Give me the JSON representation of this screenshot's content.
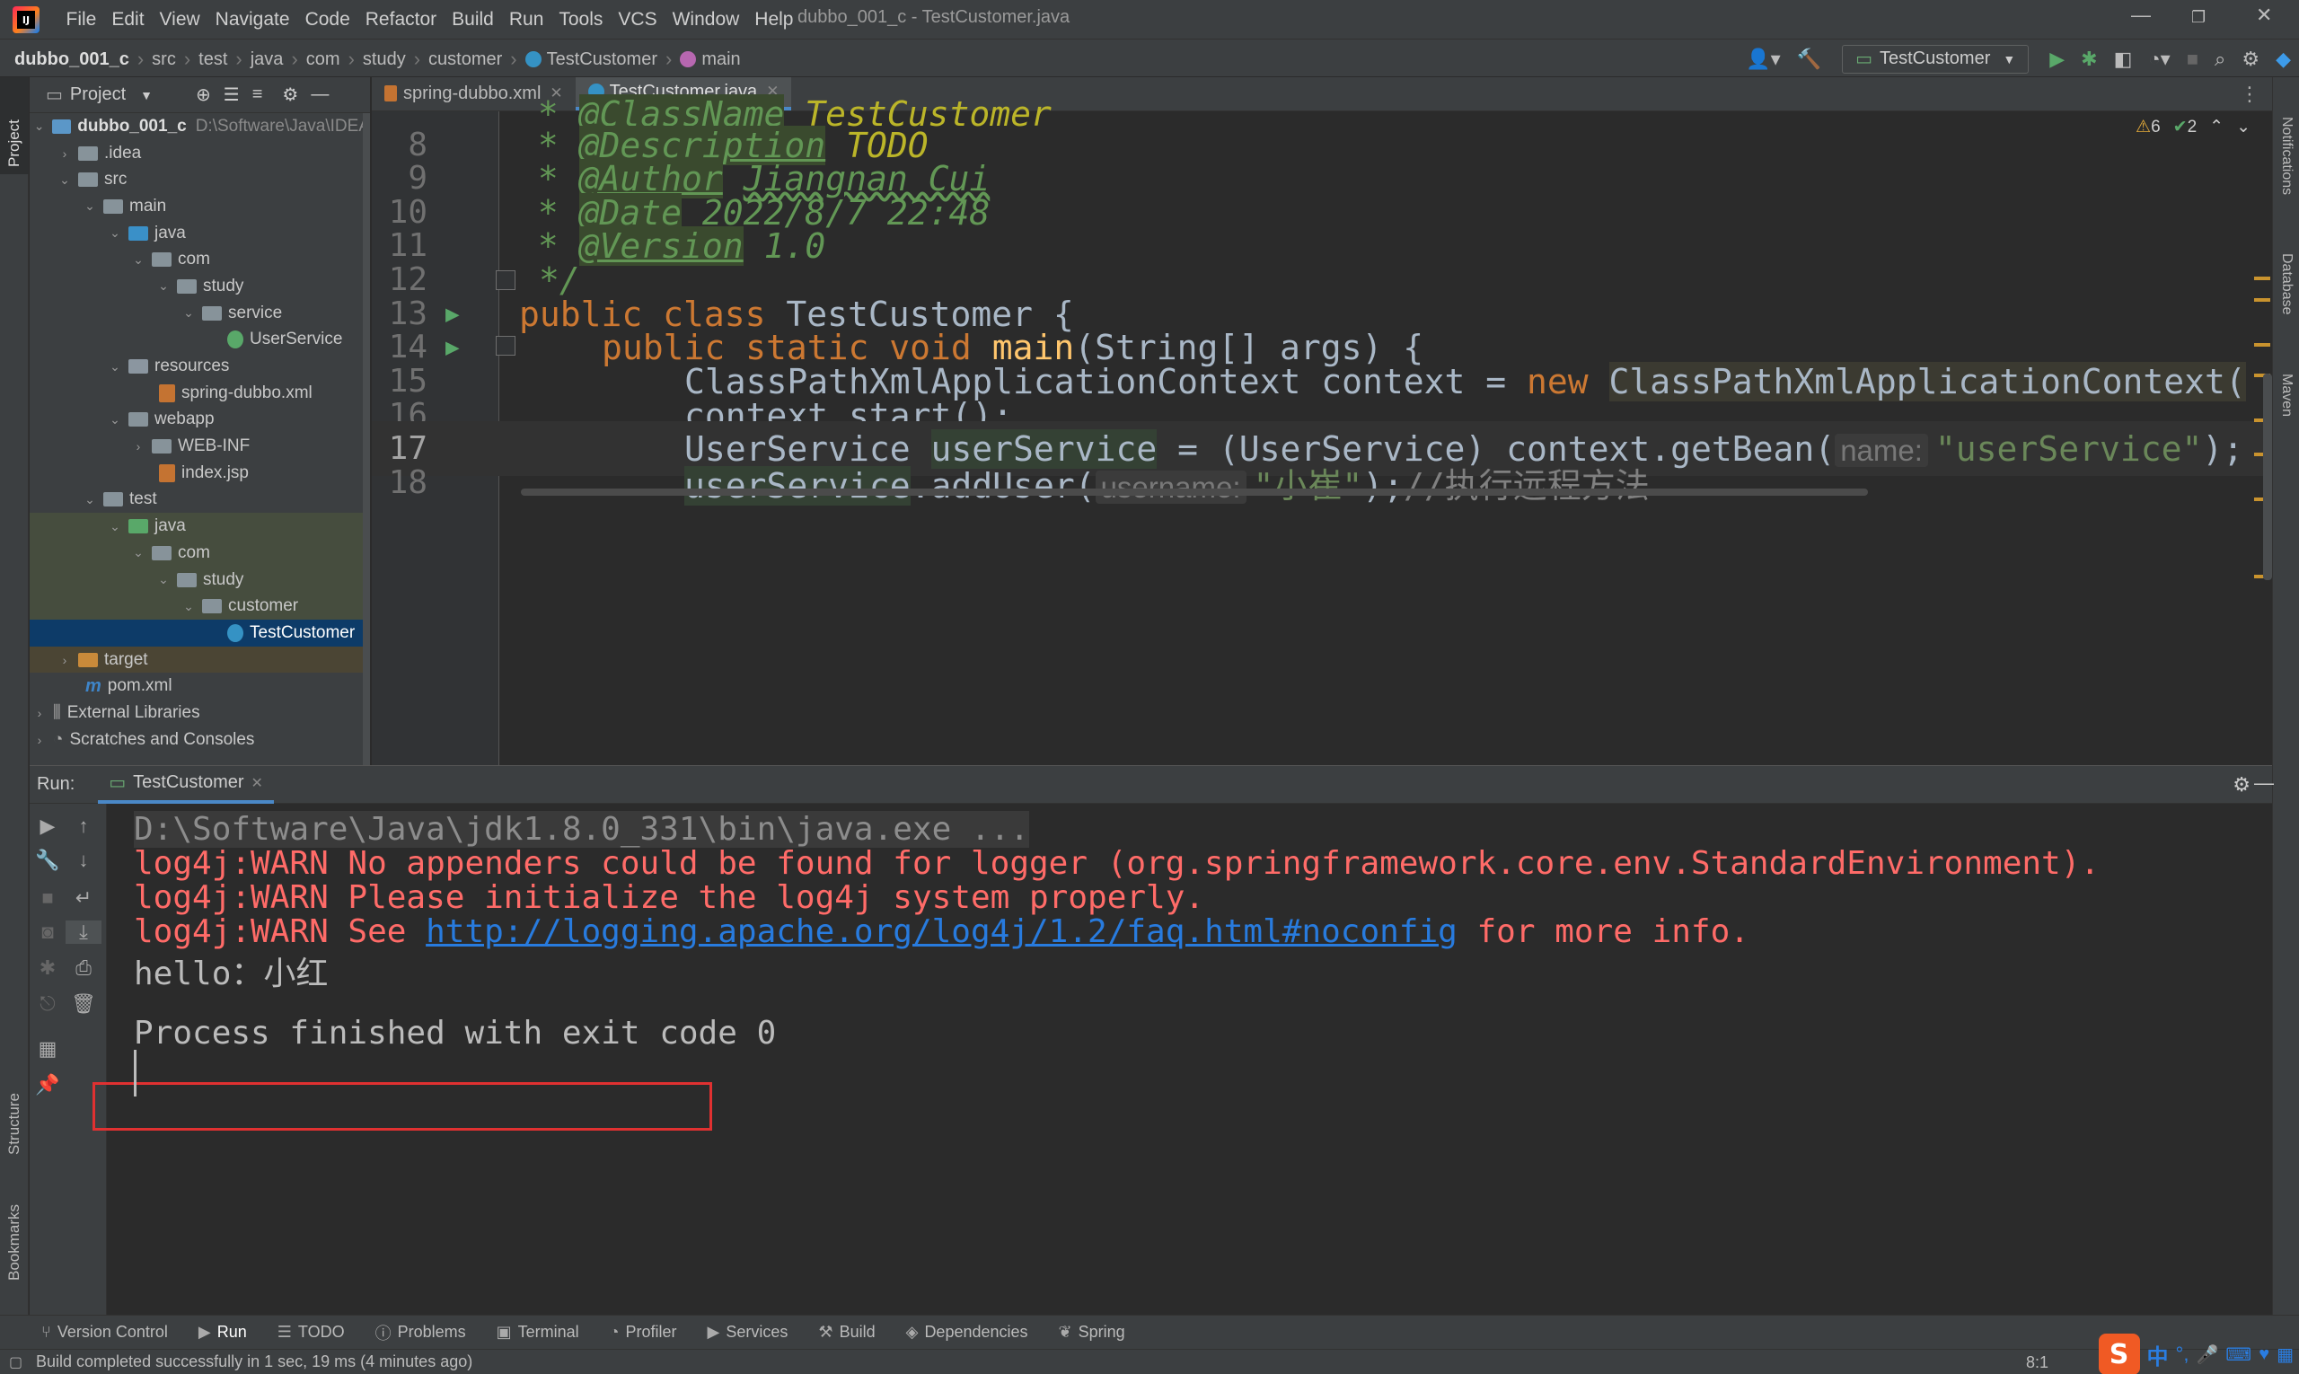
{
  "menubar": {
    "items": [
      "File",
      "Edit",
      "View",
      "Navigate",
      "Code",
      "Refactor",
      "Build",
      "Run",
      "Tools",
      "VCS",
      "Window",
      "Help"
    ],
    "window_title": "dubbo_001_c - TestCustomer.java"
  },
  "breadcrumb": [
    "dubbo_001_c",
    "src",
    "test",
    "java",
    "com",
    "study",
    "customer",
    "TestCustomer",
    "main"
  ],
  "toolbar": {
    "run_config": "TestCustomer"
  },
  "left_strip": {
    "project": "Project",
    "structure": "Structure",
    "bookmarks": "Bookmarks"
  },
  "right_strip": {
    "notifications": "Notifications",
    "database": "Database",
    "maven": "Maven"
  },
  "project_panel": {
    "title": "Project",
    "root_name": "dubbo_001_c",
    "root_path": "D:\\Software\\Java\\IDEA",
    "nodes": [
      ".idea",
      "src",
      "main",
      "java",
      "com",
      "study",
      "service",
      "UserService",
      "resources",
      "spring-dubbo.xml",
      "webapp",
      "WEB-INF",
      "index.jsp",
      "test",
      "java",
      "com",
      "study",
      "customer",
      "TestCustomer",
      "target",
      "pom.xml",
      "External Libraries",
      "Scratches and Consoles"
    ]
  },
  "editor": {
    "tabs": [
      "spring-dubbo.xml",
      "TestCustomer.java"
    ],
    "warnings": "6",
    "weak_warnings": "2",
    "lines": [
      {
        "num": "8",
        "tag": "@Description",
        "value": "TODO"
      },
      {
        "num": "9",
        "tag": "@Author",
        "value": "Jiangnan Cui"
      },
      {
        "num": "10",
        "tag": "@Date",
        "value": "2022/8/7 22:48"
      },
      {
        "num": "11",
        "tag": "@Version",
        "value": "1.0"
      },
      {
        "num": "12",
        "text": "*/"
      },
      {
        "num": "13"
      },
      {
        "num": "14"
      },
      {
        "num": "15"
      },
      {
        "num": "16"
      },
      {
        "num": "17"
      },
      {
        "num": "18"
      }
    ],
    "code": {
      "l13_kw": "public class ",
      "l13_name": "TestCustomer {",
      "l14_kw": "public static void ",
      "l14_fn": "main",
      "l14_rest": "(String[] args) {",
      "l15_a": "ClassPathXmlApplicationContext context = ",
      "l15_kw": "new ",
      "l15_b": "ClassPathXmlApplicationContext(",
      "l16": "context.start();",
      "l17_a": "UserService ",
      "l17_var": "userService",
      "l17_b": " = (UserService) context.getBean(",
      "l17_hint": "name:",
      "l17_str": "\"userService\"",
      "l17_c": ");",
      "l18_var": "userService",
      "l18_a": ".addUser(",
      "l18_hint": "username:",
      "l18_str": "\"小崔\"",
      "l18_b": ");",
      "l18_cm": "//执行远程方法"
    }
  },
  "run_panel": {
    "label": "Run:",
    "tab": "TestCustomer",
    "console": [
      "D:\\Software\\Java\\jdk1.8.0_331\\bin\\java.exe ...",
      "log4j:WARN No appenders could be found for logger (org.springframework.core.env.StandardEnvironment).",
      "log4j:WARN Please initialize the log4j system properly.",
      "log4j:WARN See ",
      "http://logging.apache.org/log4j/1.2/faq.html#noconfig",
      " for more info.",
      "hello：小红",
      "Process finished with exit code 0"
    ]
  },
  "tool_windows": [
    "Version Control",
    "Run",
    "TODO",
    "Problems",
    "Terminal",
    "Profiler",
    "Services",
    "Build",
    "Dependencies",
    "Spring"
  ],
  "status": {
    "message": "Build completed successfully in 1 sec, 19 ms (4 minutes ago)",
    "position": "8:1",
    "ime_mode": "中"
  }
}
